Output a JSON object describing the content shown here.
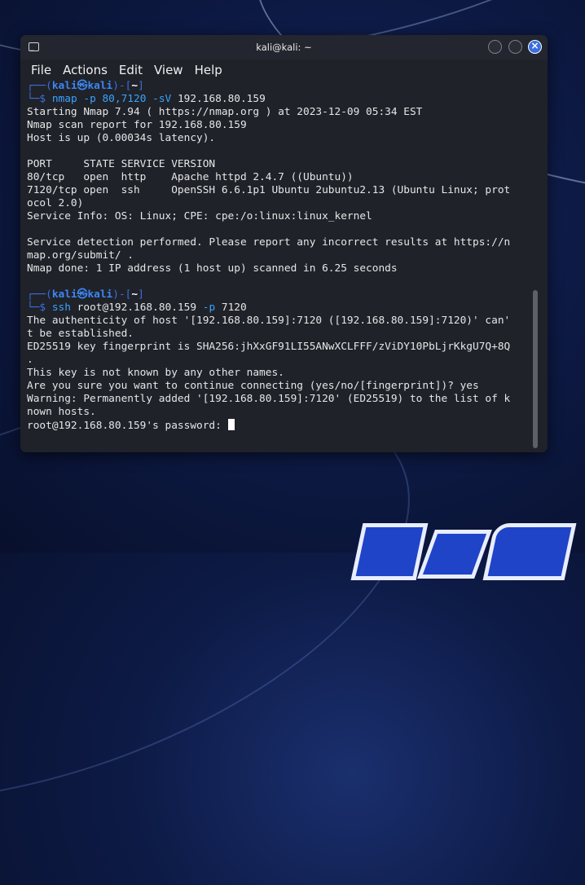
{
  "window": {
    "title": "kali@kali: ~",
    "menu": [
      "File",
      "Actions",
      "Edit",
      "View",
      "Help"
    ],
    "icons": {
      "terminal": "terminal-icon",
      "minimize": "minimize-icon",
      "maximize": "maximize-icon",
      "close": "close-icon"
    }
  },
  "terminal": {
    "prompt1": {
      "corner": "┌──(",
      "user": "kali㉿kali",
      "sep": ")-[",
      "path": "~",
      "end": "]",
      "dollar": "└─$ ",
      "cmd": "nmap",
      "args": " -p 80,7120 -sV ",
      "target": "192.168.80.159"
    },
    "output1": [
      "Starting Nmap 7.94 ( https://nmap.org ) at 2023-12-09 05:34 EST",
      "Nmap scan report for 192.168.80.159",
      "Host is up (0.00034s latency).",
      "",
      "PORT     STATE SERVICE VERSION",
      "80/tcp   open  http    Apache httpd 2.4.7 ((Ubuntu))",
      "7120/tcp open  ssh     OpenSSH 6.6.1p1 Ubuntu 2ubuntu2.13 (Ubuntu Linux; prot",
      "ocol 2.0)",
      "Service Info: OS: Linux; CPE: cpe:/o:linux:linux_kernel",
      "",
      "Service detection performed. Please report any incorrect results at https://n",
      "map.org/submit/ .",
      "Nmap done: 1 IP address (1 host up) scanned in 6.25 seconds",
      ""
    ],
    "prompt2": {
      "corner": "┌──(",
      "user": "kali㉿kali",
      "sep": ")-[",
      "path": "~",
      "end": "]",
      "dollar": "└─$ ",
      "cmd": "ssh",
      "args1": " root@192.168.80.159 ",
      "flag": "-p",
      "args2": " 7120"
    },
    "output2": [
      "The authenticity of host '[192.168.80.159]:7120 ([192.168.80.159]:7120)' can'",
      "t be established.",
      "ED25519 key fingerprint is SHA256:jhXxGF91LI55ANwXCLFFF/zViDY10PbLjrKkgU7Q+8Q",
      ".",
      "This key is not known by any other names.",
      "Are you sure you want to continue connecting (yes/no/[fingerprint])? yes",
      "Warning: Permanently added '[192.168.80.159]:7120' (ED25519) to the list of k",
      "nown hosts."
    ],
    "password_prompt": "root@192.168.80.159's password: "
  }
}
